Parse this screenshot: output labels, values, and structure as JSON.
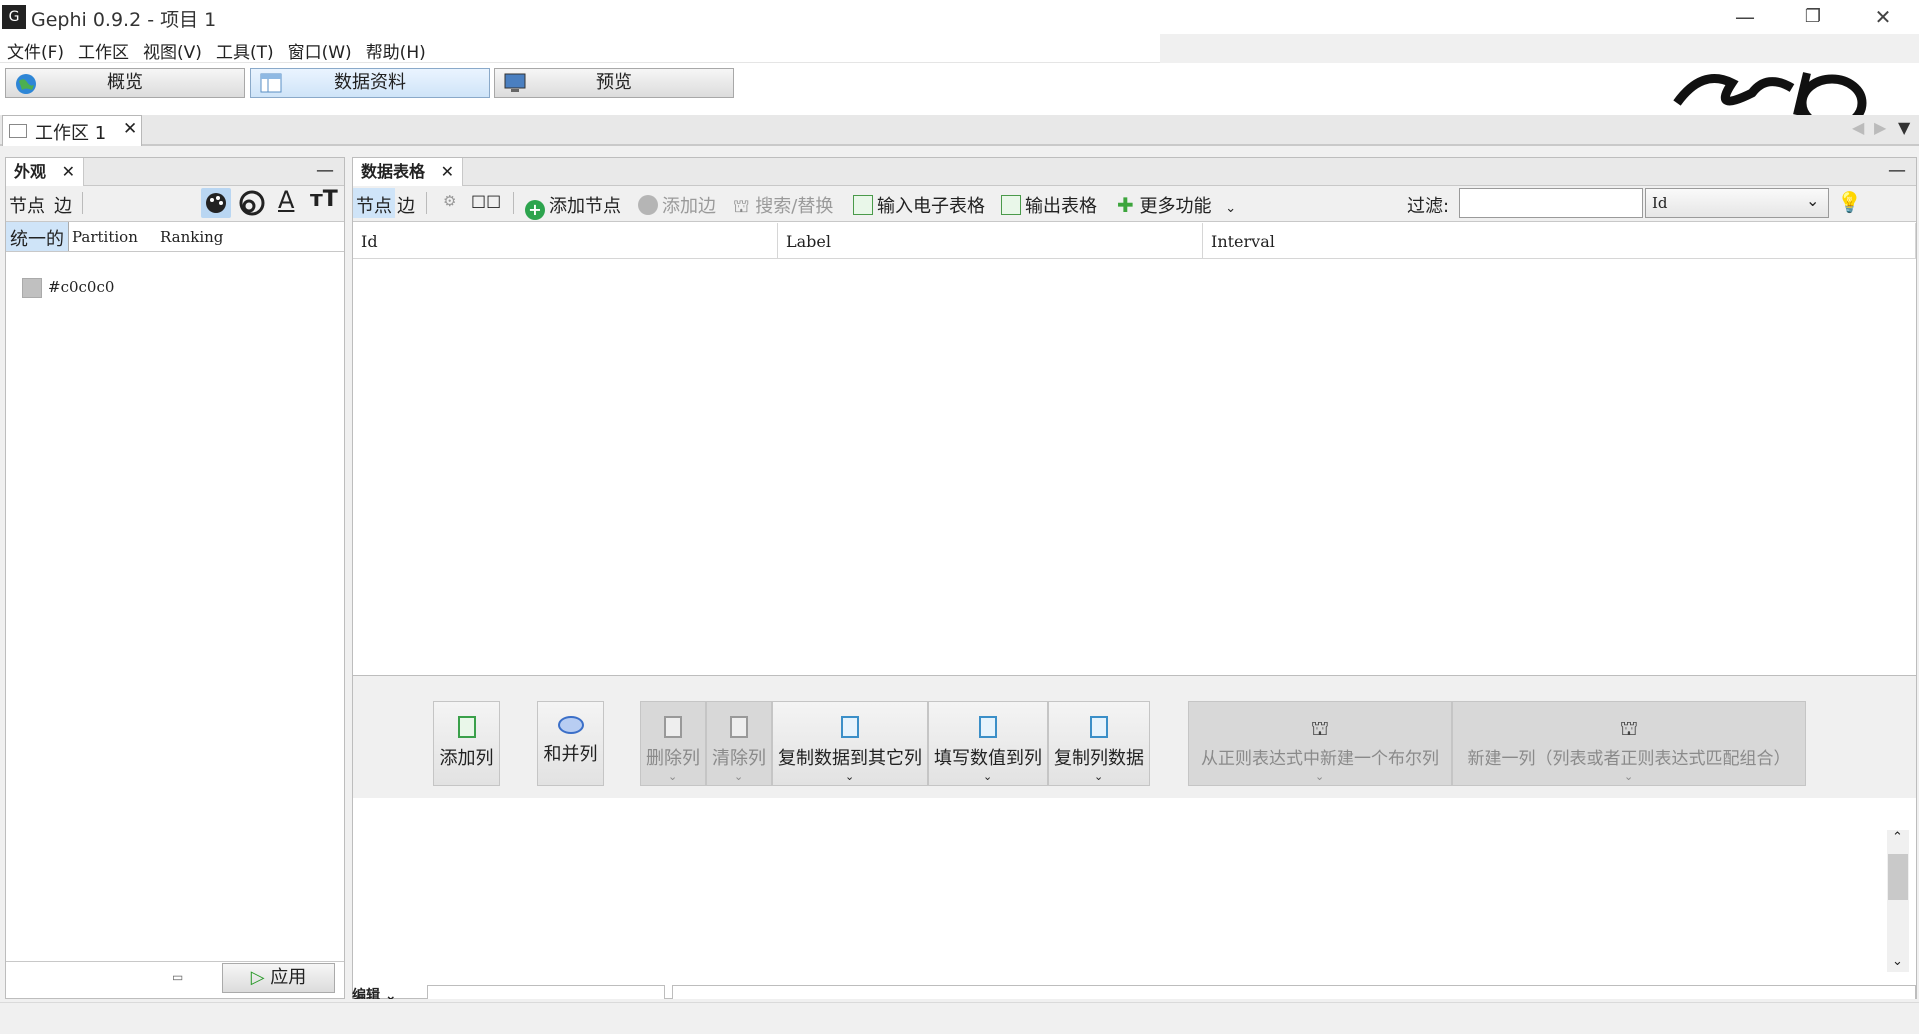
{
  "window": {
    "title": "Gephi 0.9.2 - 项目 1",
    "controls": {
      "minimize": "—",
      "restore": "❐",
      "close": "✕"
    }
  },
  "menu": [
    "文件(F)",
    "工作区",
    "视图(V)",
    "工具(T)",
    "窗口(W)",
    "帮助(H)"
  ],
  "modes": [
    {
      "label": "概览",
      "icon": "globe-icon"
    },
    {
      "label": "数据资料",
      "icon": "table-icon",
      "active": true
    },
    {
      "label": "预览",
      "icon": "monitor-icon"
    }
  ],
  "workspace_tab": {
    "label": "工作区 1",
    "close": "✕"
  },
  "appearance_panel": {
    "tab_label": "外观",
    "close": "✕",
    "minimize": "—",
    "subtabs": [
      "节点",
      "边"
    ],
    "mode_tabs": [
      "统一的",
      "Partition",
      "Ranking"
    ],
    "color_value": "#c0c0c0",
    "apply_label": "应用"
  },
  "data_table": {
    "tab_label": "数据表格",
    "close": "✕",
    "minimize": "—",
    "subtabs": [
      "节点",
      "边"
    ],
    "toolbar": {
      "add_node": "添加节点",
      "add_edge": "添加边",
      "search_replace": "搜索/替换",
      "import_spreadsheet": "输入电子表格",
      "export_table": "输出表格",
      "more_actions": "更多功能",
      "filter_label": "过滤:",
      "filter_value": "",
      "filter_column": "Id"
    },
    "columns": [
      "Id",
      "Label",
      "Interval"
    ],
    "rows": []
  },
  "column_actions": [
    {
      "label": "添加列",
      "enabled": true
    },
    {
      "label": "和并列",
      "enabled": true
    },
    {
      "label": "删除列",
      "enabled": false
    },
    {
      "label": "清除列",
      "enabled": false
    },
    {
      "label": "复制数据到其它列",
      "enabled": true
    },
    {
      "label": "填写数值到列",
      "enabled": true
    },
    {
      "label": "复制列数据",
      "enabled": true
    },
    {
      "label": "从正则表达式中新建一个布尔列",
      "enabled": false
    },
    {
      "label": "新建一列（列表或者正则表达式匹配组合）",
      "enabled": false
    }
  ],
  "bottom_tab": {
    "label": "编辑"
  },
  "colors": {
    "accent_tab": "#cfe4f8",
    "disabled_btn": "#d8d8d8",
    "node_color": "#c0c0c0"
  }
}
